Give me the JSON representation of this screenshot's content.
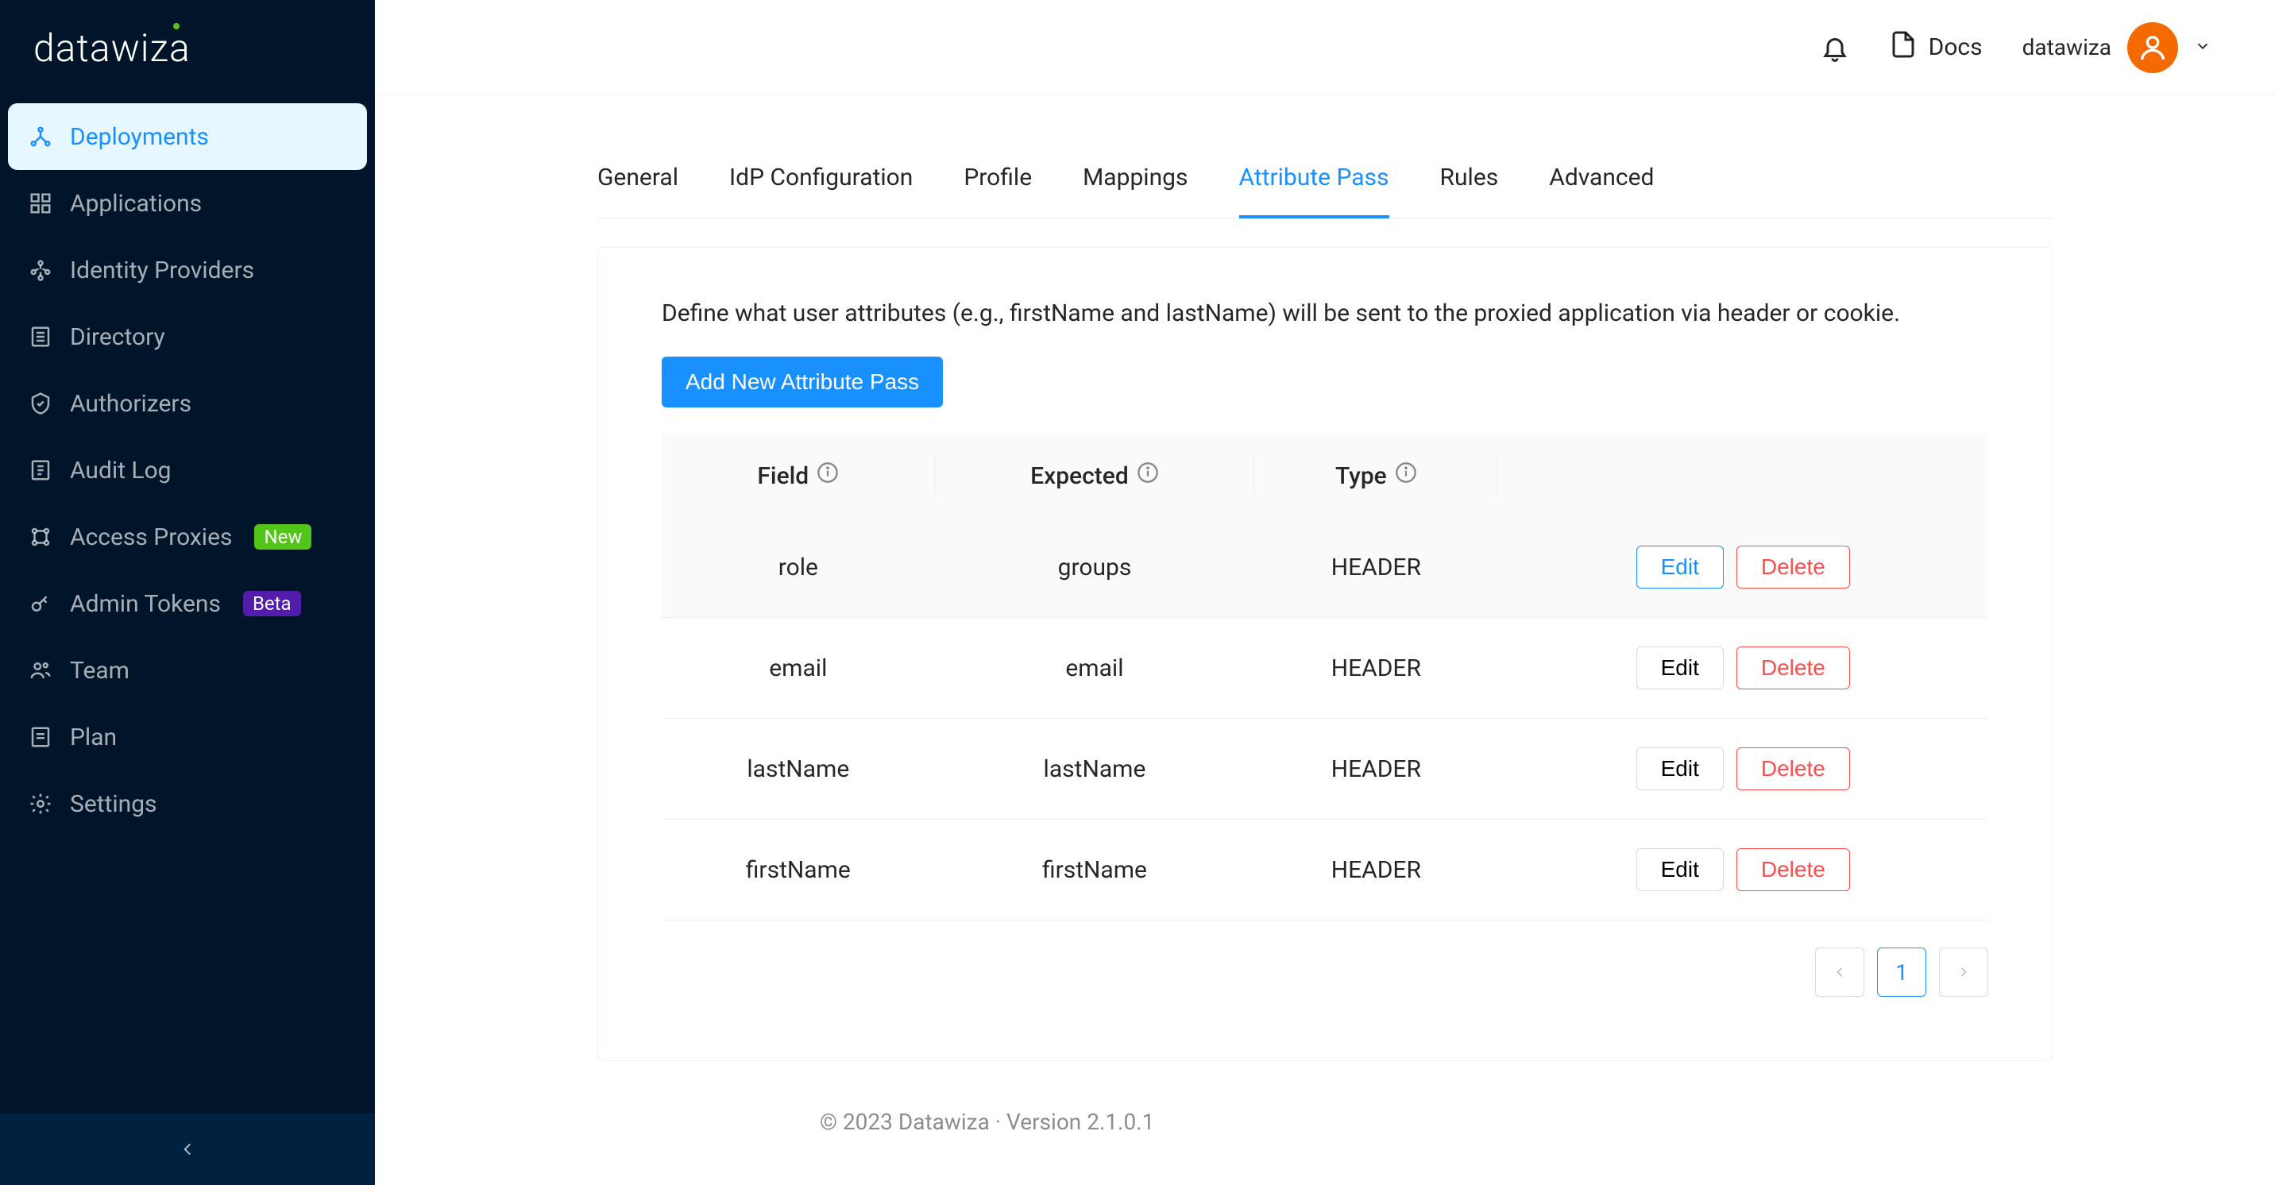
{
  "brand": {
    "name": "datawiza"
  },
  "sidebar": {
    "items": [
      {
        "label": "Deployments",
        "badge": null
      },
      {
        "label": "Applications",
        "badge": null
      },
      {
        "label": "Identity Providers",
        "badge": null
      },
      {
        "label": "Directory",
        "badge": null
      },
      {
        "label": "Authorizers",
        "badge": null
      },
      {
        "label": "Audit Log",
        "badge": null
      },
      {
        "label": "Access Proxies",
        "badge": "New"
      },
      {
        "label": "Admin Tokens",
        "badge": "Beta"
      },
      {
        "label": "Team",
        "badge": null
      },
      {
        "label": "Plan",
        "badge": null
      },
      {
        "label": "Settings",
        "badge": null
      }
    ]
  },
  "header": {
    "docs_label": "Docs",
    "username": "datawiza"
  },
  "tabs": [
    "General",
    "IdP Configuration",
    "Profile",
    "Mappings",
    "Attribute Pass",
    "Rules",
    "Advanced"
  ],
  "active_tab_index": 4,
  "panel": {
    "description": "Define what user attributes (e.g., firstName and lastName) will be sent to the proxied application via header or cookie.",
    "add_button": "Add New Attribute Pass",
    "columns": {
      "field": "Field",
      "expected": "Expected",
      "type": "Type"
    },
    "rows": [
      {
        "field": "role",
        "expected": "groups",
        "type": "HEADER"
      },
      {
        "field": "email",
        "expected": "email",
        "type": "HEADER"
      },
      {
        "field": "lastName",
        "expected": "lastName",
        "type": "HEADER"
      },
      {
        "field": "firstName",
        "expected": "firstName",
        "type": "HEADER"
      }
    ],
    "actions": {
      "edit": "Edit",
      "delete": "Delete"
    }
  },
  "pagination": {
    "current": "1"
  },
  "footer": "© 2023 Datawiza · Version 2.1.0.1"
}
